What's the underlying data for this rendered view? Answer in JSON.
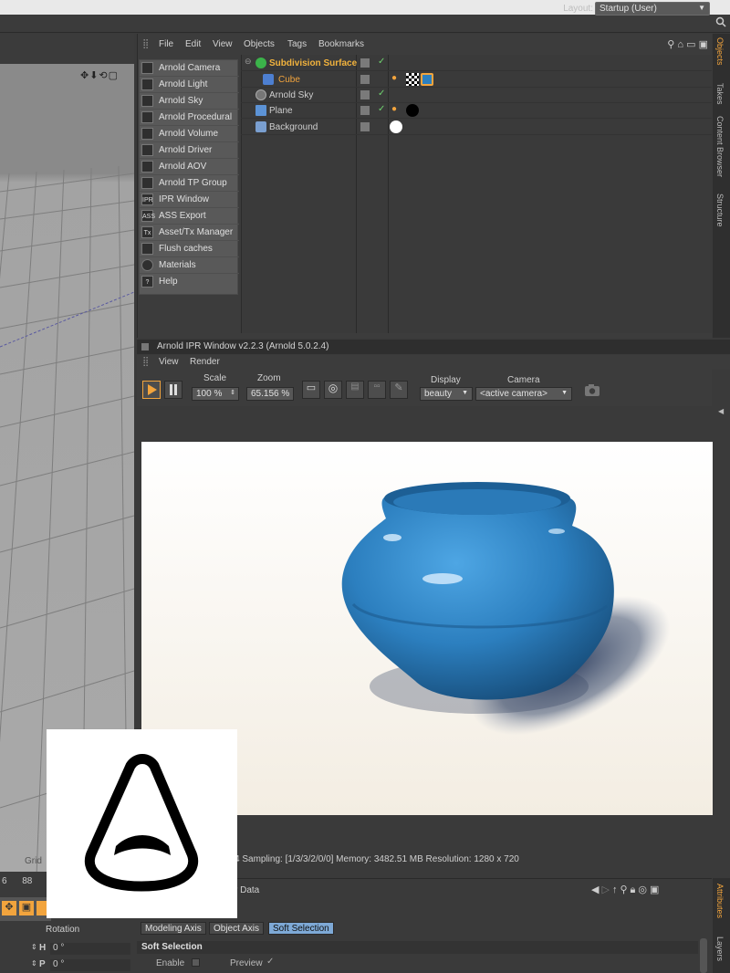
{
  "layout": {
    "label": "Layout:",
    "value": "Startup (User)"
  },
  "object_manager": {
    "menu": [
      "File",
      "Edit",
      "View",
      "Objects",
      "Tags",
      "Bookmarks"
    ],
    "plugin_menu": [
      {
        "icon": "camera-icon",
        "glyph": "",
        "label": "Arnold Camera"
      },
      {
        "icon": "light-icon",
        "glyph": "",
        "label": "Arnold Light"
      },
      {
        "icon": "sky-icon",
        "glyph": "",
        "label": "Arnold Sky"
      },
      {
        "icon": "procedural-icon",
        "glyph": "",
        "label": "Arnold Procedural"
      },
      {
        "icon": "volume-icon",
        "glyph": "",
        "label": "Arnold Volume"
      },
      {
        "icon": "driver-icon",
        "glyph": "",
        "label": "Arnold Driver"
      },
      {
        "icon": "aov-icon",
        "glyph": "",
        "label": "Arnold AOV"
      },
      {
        "icon": "tp-group-icon",
        "glyph": "",
        "label": "Arnold TP Group"
      },
      {
        "icon": "ipr-icon",
        "glyph": "IPR",
        "label": "IPR Window"
      },
      {
        "icon": "ass-icon",
        "glyph": "ASS",
        "label": "ASS Export"
      },
      {
        "icon": "tx-icon",
        "glyph": "Tx",
        "label": "Asset/Tx Manager"
      },
      {
        "icon": "trash-icon",
        "glyph": "",
        "label": "Flush caches"
      },
      {
        "icon": "materials-icon",
        "glyph": "",
        "label": "Materials"
      },
      {
        "icon": "help-icon",
        "glyph": "?",
        "label": "Help"
      }
    ],
    "objects": [
      {
        "name": "Subdivision Surface",
        "color": "#f2b33d"
      },
      {
        "name": "Cube",
        "color": "#f2a43d"
      },
      {
        "name": "Arnold Sky",
        "color": "#cfcfcf"
      },
      {
        "name": "Plane",
        "color": "#cfcfcf"
      },
      {
        "name": "Background",
        "color": "#cfcfcf"
      }
    ]
  },
  "side_tabs": [
    "Objects",
    "Takes",
    "Content Browser",
    "Structure"
  ],
  "ipr": {
    "title": "Arnold IPR Window v2.2.3 (Arnold 5.0.2.4)",
    "menu": [
      "View",
      "Render"
    ],
    "scale_label": "Scale",
    "scale_value": "100 %",
    "zoom_label": "Zoom",
    "zoom_value": "65.156 %",
    "display_label": "Display",
    "display_value": "beauty",
    "camera_label": "Camera",
    "camera_value": "<active camera>",
    "status": "4  Sampling: [1/3/3/2/0/0]  Memory: 3482.51 MB  Resolution: 1280 x 720"
  },
  "viewport": {
    "grid_label": "Grid"
  },
  "coords": {
    "nums": "6      88",
    "rotation_label": "Rotation",
    "rows": [
      {
        "axis": "H",
        "value": "0 °"
      },
      {
        "axis": "P",
        "value": "0 °"
      }
    ]
  },
  "attributes": {
    "title": "r Data",
    "tabs": [
      "Modeling Axis",
      "Object Axis",
      "Soft Selection"
    ],
    "section": "Soft Selection",
    "enable_label": "Enable",
    "preview_label": "Preview",
    "preview_check": "✓",
    "side_tabs": [
      "Attributes",
      "Layers"
    ]
  },
  "colors": {
    "accent": "#f2a43d",
    "check": "#6fd36f",
    "pot": "#2c7fbf"
  }
}
